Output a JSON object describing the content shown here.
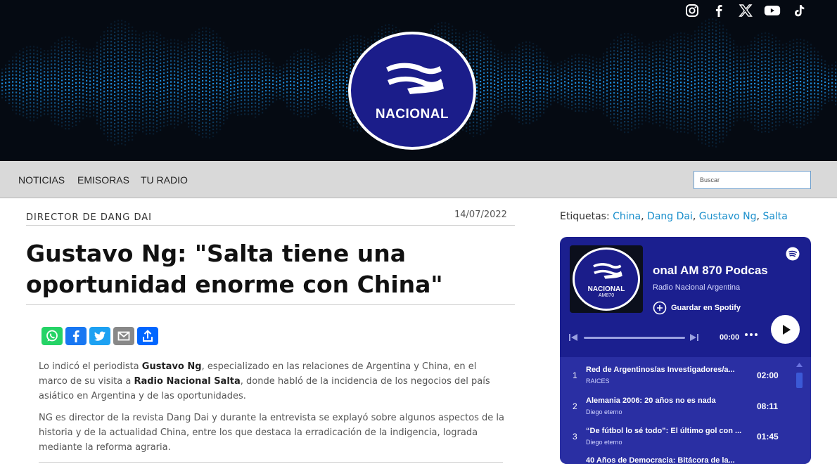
{
  "brand": {
    "name": "NACIONAL"
  },
  "social": [
    {
      "icon": "instagram-icon"
    },
    {
      "icon": "facebook-icon"
    },
    {
      "icon": "x-icon"
    },
    {
      "icon": "youtube-icon"
    },
    {
      "icon": "tiktok-icon"
    }
  ],
  "nav": {
    "items": [
      "NOTICIAS",
      "EMISORAS",
      "TU RADIO"
    ],
    "search_placeholder": "Buscar"
  },
  "article": {
    "kicker": "DIRECTOR DE DANG DAI",
    "date": "14/07/2022",
    "title": "Gustavo Ng: \"Salta tiene una oportunidad enorme con China\"",
    "share": [
      {
        "icon": "whatsapp-icon",
        "color": "#25d366"
      },
      {
        "icon": "facebook-icon",
        "color": "#1877f2"
      },
      {
        "icon": "twitter-icon",
        "color": "#1da1f2"
      },
      {
        "icon": "email-icon",
        "color": "#888888"
      },
      {
        "icon": "share-icon",
        "color": "#0166ff"
      }
    ],
    "p1": {
      "t1": "Lo indicó el periodista ",
      "b1": "Gustavo Ng",
      "t2": ", especializado en las relaciones de Argentina y China, en el marco de su visita a ",
      "b2": "Radio Nacional Salta",
      "t3": ", donde habló de la incidencia de los negocios del país asiático en Argentina y de las oportunidades."
    },
    "p2": "NG es director de la revista Dang Dai y durante la entrevista se explayó sobre algunos aspectos de la historia y de la actualidad China, entre los que destaca la erradicación de la indigencia, lograda mediante la reforma agraria."
  },
  "tags": {
    "label": "Etiquetas:",
    "items": [
      "China",
      "Dang Dai",
      "Gustavo Ng",
      "Salta"
    ]
  },
  "spotify": {
    "cover_name": "NACIONAL",
    "cover_sub": "AM870",
    "show_title": "onal AM 870 Podcas",
    "artist": "Radio Nacional Argentina",
    "save_label": "Guardar en Spotify",
    "time": "00:00",
    "tracks": [
      {
        "num": "1",
        "title": "Red de Argentinos/as Investigadores/a...",
        "sub": "RAICES",
        "dur": "02:00"
      },
      {
        "num": "2",
        "title": "Alemania 2006: 20 años no es nada",
        "sub": "Diego eterno",
        "dur": "08:11"
      },
      {
        "num": "3",
        "title": "“De fútbol lo sé todo”: El último gol con ...",
        "sub": "Diego eterno",
        "dur": "01:45"
      },
      {
        "num": "",
        "title": "40 Años de Democracia: Bitácora de la...",
        "sub": "",
        "dur": ""
      }
    ]
  }
}
